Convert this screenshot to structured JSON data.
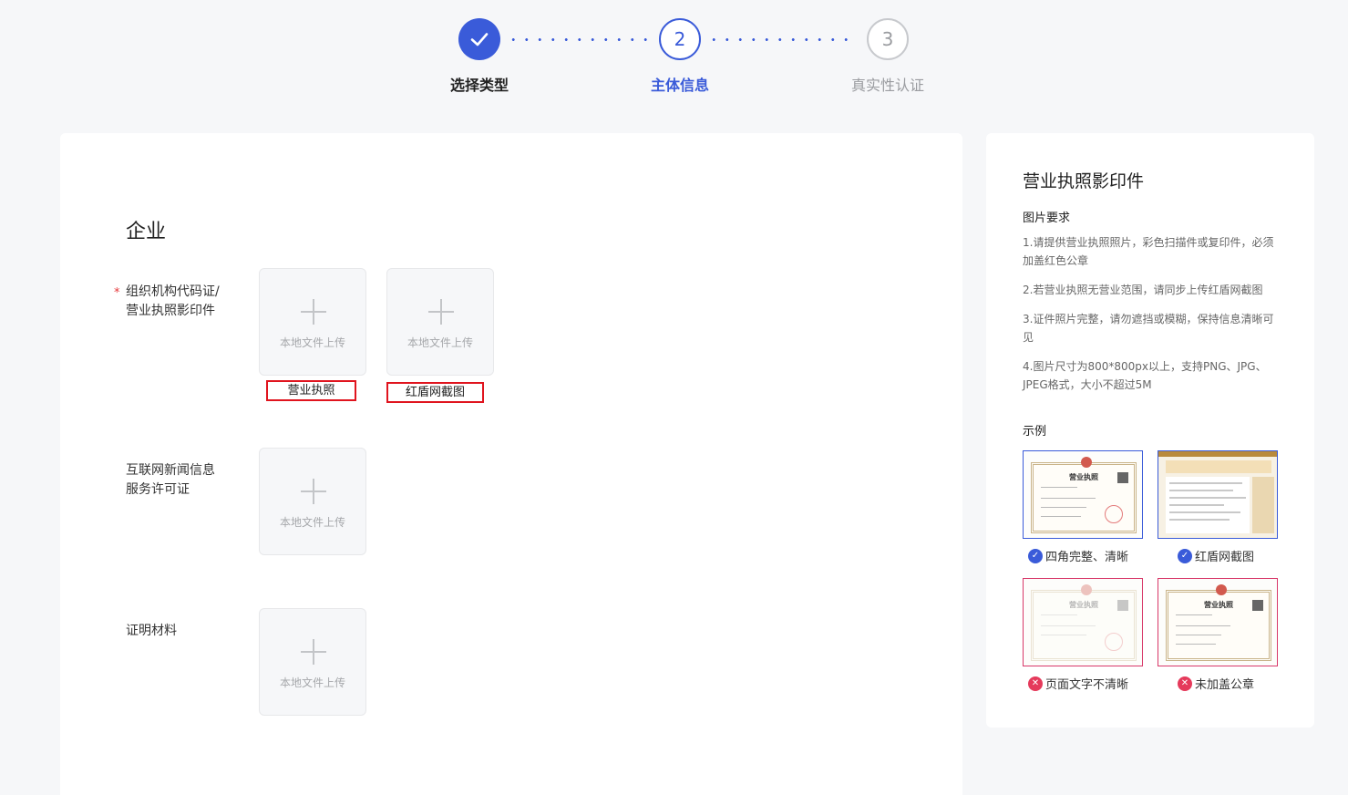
{
  "stepper": {
    "steps": [
      {
        "number": "",
        "label": "选择类型",
        "state": "done"
      },
      {
        "number": "2",
        "label": "主体信息",
        "state": "active"
      },
      {
        "number": "3",
        "label": "真实性认证",
        "state": "pending"
      }
    ],
    "accent_color": "#3a5bd9"
  },
  "form": {
    "section_title": "企业",
    "required_mark": "*",
    "upload_text": "本地文件上传",
    "fields": [
      {
        "label_line1": "组织机构代码证/",
        "label_line2": "营业执照影印件",
        "required": true,
        "captions": [
          "营业执照",
          "红盾网截图"
        ]
      },
      {
        "label_line1": "互联网新闻信息",
        "label_line2": "服务许可证",
        "required": false
      },
      {
        "label_line1": "证明材料",
        "label_line2": "",
        "required": false
      }
    ]
  },
  "side": {
    "title": "营业执照影印件",
    "requirements_title": "图片要求",
    "requirements": [
      "1.请提供营业执照照片，彩色扫描件或复印件，必须加盖红色公章",
      "2.若营业执照无营业范围，请同步上传红盾网截图",
      "3.证件照片完整，请勿遮挡或模糊，保持信息清晰可见",
      "4.图片尺寸为800*800px以上，支持PNG、JPG、JPEG格式，大小不超过5M"
    ],
    "examples_title": "示例",
    "examples": [
      {
        "caption": "四角完整、清晰",
        "status": "good"
      },
      {
        "caption": "红盾网截图",
        "status": "good"
      },
      {
        "caption": "页面文字不清晰",
        "status": "bad"
      },
      {
        "caption": "未加盖公章",
        "status": "bad"
      }
    ],
    "cert_heading": "营业执照"
  }
}
